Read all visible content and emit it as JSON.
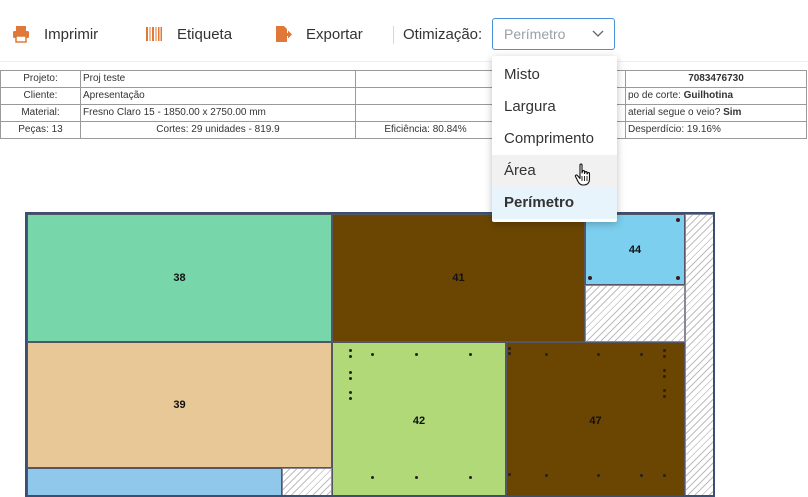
{
  "toolbar": {
    "print_label": "Imprimir",
    "label_label": "Etiqueta",
    "export_label": "Exportar",
    "optimization_label": "Otimização:",
    "optimization_value": "Perímetro"
  },
  "dropdown": {
    "options": [
      "Misto",
      "Largura",
      "Comprimento",
      "Área",
      "Perímetro"
    ],
    "hovered": "Área",
    "selected": "Perímetro"
  },
  "info": {
    "project_label": "Projeto:",
    "project_value": "Proj teste",
    "client_label": "Cliente:",
    "client_value": "Apresentação",
    "material_label": "Material:",
    "material_value": "Fresno Claro 15 - 1850.00 x 2750.00 mm",
    "pieces": "Peças: 13",
    "cuts": "Cortes: 29 unidades - 819.9",
    "efficiency": "Eficiência: 80.84%",
    "code": "7083476730",
    "cut_type_label": "po de corte:",
    "cut_type_value": "Guilhotina",
    "grain_label": "aterial segue o veio?",
    "grain_value": "Sim",
    "waste": "Desperdício: 19.16%"
  },
  "plan": {
    "pieces": [
      {
        "id": "38",
        "color": "#77d7ab"
      },
      {
        "id": "41",
        "color": "#6b4603"
      },
      {
        "id": "44",
        "color": "#7ccfef"
      },
      {
        "id": "39",
        "color": "#e8c896"
      },
      {
        "id": "42",
        "color": "#b2d977"
      },
      {
        "id": "47",
        "color": "#6b4603"
      },
      {
        "id": "",
        "color": "#8fc8ea"
      }
    ]
  },
  "colors": {
    "accent_orange": "#e0783a",
    "select_border": "#4a90d9",
    "plan_border": "#3b4f72"
  }
}
